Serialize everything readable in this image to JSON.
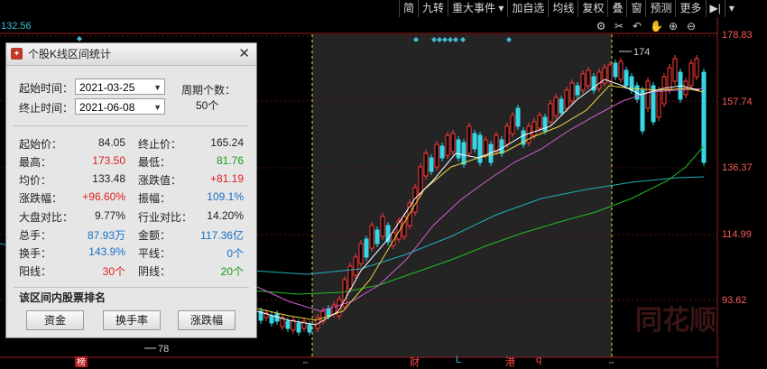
{
  "toolbar": {
    "items": [
      "简",
      "九转",
      "重大事件 ▾",
      "加自选",
      "均线",
      "复权",
      "叠",
      "窗",
      "预测",
      "更多",
      "▶|",
      "▾"
    ]
  },
  "top_left_price": "132.56",
  "icons": [
    "gear-icon",
    "scissors-icon",
    "undo-icon",
    "hand-icon",
    "zoom-in-icon",
    "zoom-out-icon"
  ],
  "y_axis_labels": [
    "178.83",
    "157.74",
    "136.37",
    "114.99",
    "93.62"
  ],
  "annotations": {
    "high": "174",
    "low": "78"
  },
  "bottom_markers": [
    "榜",
    "财",
    "L",
    "港",
    "q"
  ],
  "watermark": "同花顺",
  "panel": {
    "title": "个股K线区间统计",
    "start_label": "起始时间：",
    "start_value": "2021-03-25",
    "end_label": "终止时间：",
    "end_value": "2021-06-08",
    "period_label": "周期个数：",
    "period_value": "50个",
    "stats": [
      {
        "l1": "起始价：",
        "v1": "84.05",
        "c1": "blk",
        "l2": "终止价：",
        "v2": "165.24",
        "c2": "blk"
      },
      {
        "l1": "最高：",
        "v1": "173.50",
        "c1": "red",
        "l2": "最低：",
        "v2": "81.76",
        "c2": "grn"
      },
      {
        "l1": "均价：",
        "v1": "133.48",
        "c1": "blk",
        "l2": "涨跌值：",
        "v2": "+81.19",
        "c2": "red"
      },
      {
        "l1": "涨跌幅：",
        "v1": "+96.60%",
        "c1": "red",
        "l2": "振幅：",
        "v2": "109.1%",
        "c2": "blu"
      },
      {
        "l1": "大盘对比：",
        "v1": "9.77%",
        "c1": "blk",
        "l2": "行业对比：",
        "v2": "14.20%",
        "c2": "blk"
      },
      {
        "l1": "总手：",
        "v1": "87.93万",
        "c1": "blu",
        "l2": "金额：",
        "v2": "117.36亿",
        "c2": "blu"
      },
      {
        "l1": "换手：",
        "v1": "143.9%",
        "c1": "blu",
        "l2": "平线：",
        "v2": "0个",
        "c2": "blu"
      },
      {
        "l1": "阳线：",
        "v1": "30个",
        "c1": "red",
        "l2": "阴线：",
        "v2": "20个",
        "c2": "grn"
      }
    ],
    "rank_title": "该区间内股票排名",
    "buttons": [
      "资金",
      "换手率",
      "涨跌幅"
    ]
  },
  "colors": {
    "up": "#ff3b3b",
    "down": "#36d6e6",
    "ma5": "#ffffff",
    "ma10": "#f0e040",
    "ma20": "#e070e0",
    "ma60": "#20d020",
    "ma250": "#20b0c0"
  }
}
